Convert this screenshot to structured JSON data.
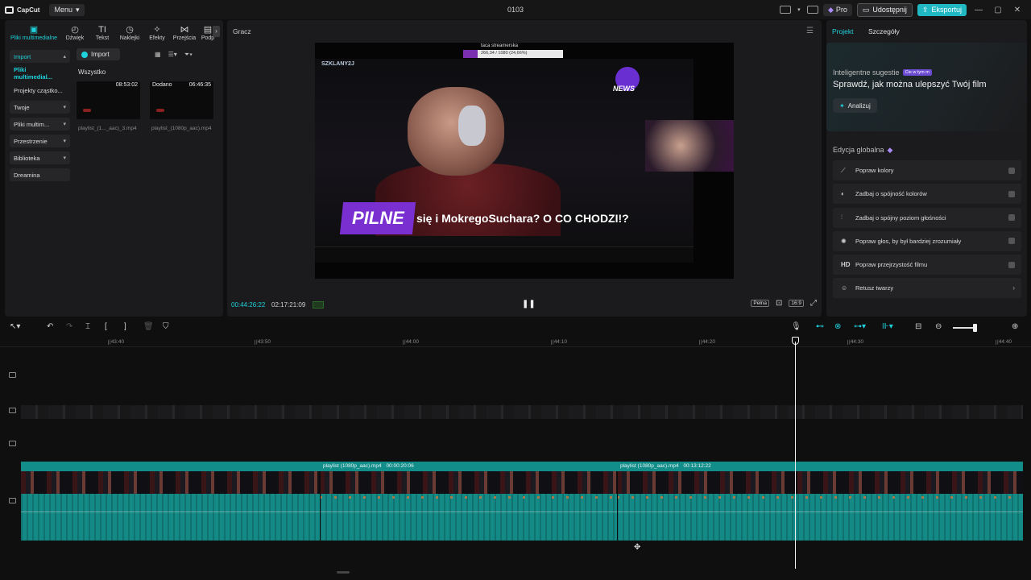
{
  "app": {
    "logo": "CapCut",
    "menu": "Menu",
    "title": "0103"
  },
  "titlebar": {
    "pro": "Pro",
    "share": "Udostępnij",
    "export": "Eksportuj"
  },
  "media": {
    "tabs": [
      "Pliki multimedialne",
      "Dźwięk",
      "Tekst",
      "Naklejki",
      "Efekty",
      "Przejścia",
      "Podp"
    ],
    "nav": [
      "Import",
      "Pliki multimedial...",
      "Projekty cząstko...",
      "Twoje",
      "Pliki multim...",
      "Przestrzenie",
      "Biblioteka",
      "Dreamina"
    ],
    "import_button": "Import",
    "all_label": "Wszystko",
    "items": [
      {
        "duration": "08:53:02",
        "name": "playlist_(1..._aac)_3.mp4",
        "tag": ""
      },
      {
        "duration": "06:46:35",
        "name": "playlist_(1080p_aac).mp4",
        "tag": "Dodano"
      }
    ]
  },
  "player": {
    "title": "Gracz",
    "current_time": "00:44:26:22",
    "total_time": "02:17:21:09",
    "full_label": "Pełna",
    "ratio_label": "16:9",
    "video": {
      "top_text": "taca streamerska",
      "bar_text": "266,34 / 1080 (24,66%)",
      "news": "NEWS",
      "handle": "SZKLANY2J",
      "pilne": "PILNE",
      "caption": "się i MokregoSuchara? O CO CHODZI!?"
    }
  },
  "right": {
    "tab_project": "Projekt",
    "tab_details": "Szczegóły",
    "suggestions_label": "Inteligentne sugestie",
    "suggestions_badge": "Cie w tym m",
    "headline": "Sprawdź, jak można ulepszyć Twój film",
    "analyze": "Analizuj",
    "global_label": "Edycja globalna",
    "items": [
      {
        "label": "Popraw kolory",
        "icon": "wand-icon"
      },
      {
        "label": "Zadbaj o spójność kolorów",
        "icon": "palette-icon"
      },
      {
        "label": "Zadbaj o spójny poziom głośności",
        "icon": "sliders-icon"
      },
      {
        "label": "Popraw głos, by był bardziej zrozumiały",
        "icon": "sparkle-voice-icon"
      },
      {
        "label": "Popraw przejrzystość filmu",
        "icon": "hd-icon"
      },
      {
        "label": "Retusz twarzy",
        "icon": "face-icon"
      }
    ]
  },
  "timeline": {
    "ruler": [
      "|43:40",
      "|43:50",
      "|44:00",
      "|44:10",
      "|44:20",
      "|44:30",
      "|44:40"
    ],
    "clips": [
      {
        "label": "",
        "duration": ""
      },
      {
        "label": "playlist (1080p_aac).mp4",
        "duration": "00:00:20:06"
      },
      {
        "label": "playlist (1080p_aac).mp4",
        "duration": "00:13:12:22"
      }
    ]
  }
}
